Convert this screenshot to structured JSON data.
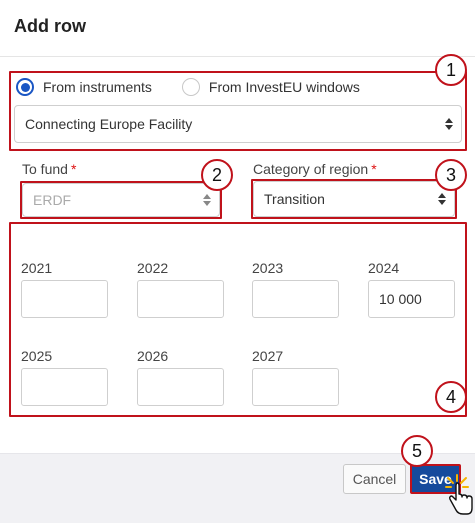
{
  "dialog": {
    "title": "Add row"
  },
  "source": {
    "options": [
      {
        "label": "From instruments",
        "checked": true
      },
      {
        "label": "From InvestEU windows",
        "checked": false
      }
    ],
    "instrument_value": "Connecting Europe Facility"
  },
  "to_fund": {
    "label": "To fund",
    "required_mark": "*",
    "value": "ERDF",
    "disabled": true
  },
  "category": {
    "label": "Category of region",
    "required_mark": "*",
    "value": "Transition"
  },
  "years": [
    {
      "label": "2021",
      "value": ""
    },
    {
      "label": "2022",
      "value": ""
    },
    {
      "label": "2023",
      "value": ""
    },
    {
      "label": "2024",
      "value": "10 000"
    },
    {
      "label": "2025",
      "value": ""
    },
    {
      "label": "2026",
      "value": ""
    },
    {
      "label": "2027",
      "value": ""
    }
  ],
  "footer": {
    "cancel_label": "Cancel",
    "save_label": "Save"
  },
  "callouts": [
    "1",
    "2",
    "3",
    "4",
    "5"
  ],
  "colors": {
    "callout": "#c0121b",
    "primary": "#164a9c",
    "radio": "#1a56c4",
    "required": "#dd1111"
  },
  "icons": {
    "cursor": "hand-pointer-icon",
    "select_arrows": "sort-arrows-icon"
  }
}
